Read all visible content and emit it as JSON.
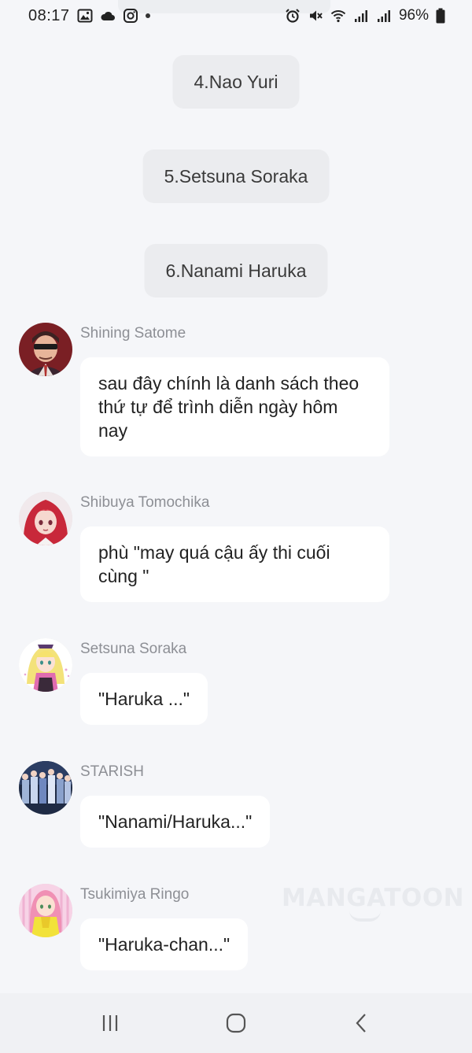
{
  "status_bar": {
    "time": "08:17",
    "battery": "96%",
    "left_icons": [
      "gallery-icon",
      "cloud-icon",
      "instagram-icon",
      "dot-icon"
    ],
    "right_icons": [
      "alarm-icon",
      "mute-icon",
      "wifi-icon",
      "signal-icon",
      "signal-icon",
      "battery-icon"
    ]
  },
  "choices": [
    {
      "label": "4.Nao Yuri"
    },
    {
      "label": "5.Setsuna Soraka"
    },
    {
      "label": "6.Nanami Haruka"
    }
  ],
  "messages": [
    {
      "sender": "Shining Satome",
      "text": "sau đây chính là danh sách theo thứ tự để trình diễn ngày hôm nay",
      "avatar": "avatar-shining-satome"
    },
    {
      "sender": "Shibuya Tomochika",
      "text": "phù \"may quá cậu ấy thi cuối cùng \"",
      "avatar": "avatar-shibuya-tomochika"
    },
    {
      "sender": "Setsuna Soraka",
      "text": "\"Haruka ...\"",
      "avatar": "avatar-setsuna-soraka"
    },
    {
      "sender": "STARISH",
      "text": "\"Nanami/Haruka...\"",
      "avatar": "avatar-starish"
    },
    {
      "sender": "Tsukimiya Ringo",
      "text": "\"Haruka-chan...\"",
      "avatar": "avatar-tsukimiya-ringo"
    }
  ],
  "watermark": "MANGATOON",
  "nav_bar": {
    "buttons": [
      "recent-apps-icon",
      "home-icon",
      "back-icon"
    ]
  },
  "colors": {
    "background": "#f5f6f9",
    "choice_bg": "#ebecef",
    "bubble_bg": "#ffffff",
    "sender_text": "#8d8f95"
  }
}
